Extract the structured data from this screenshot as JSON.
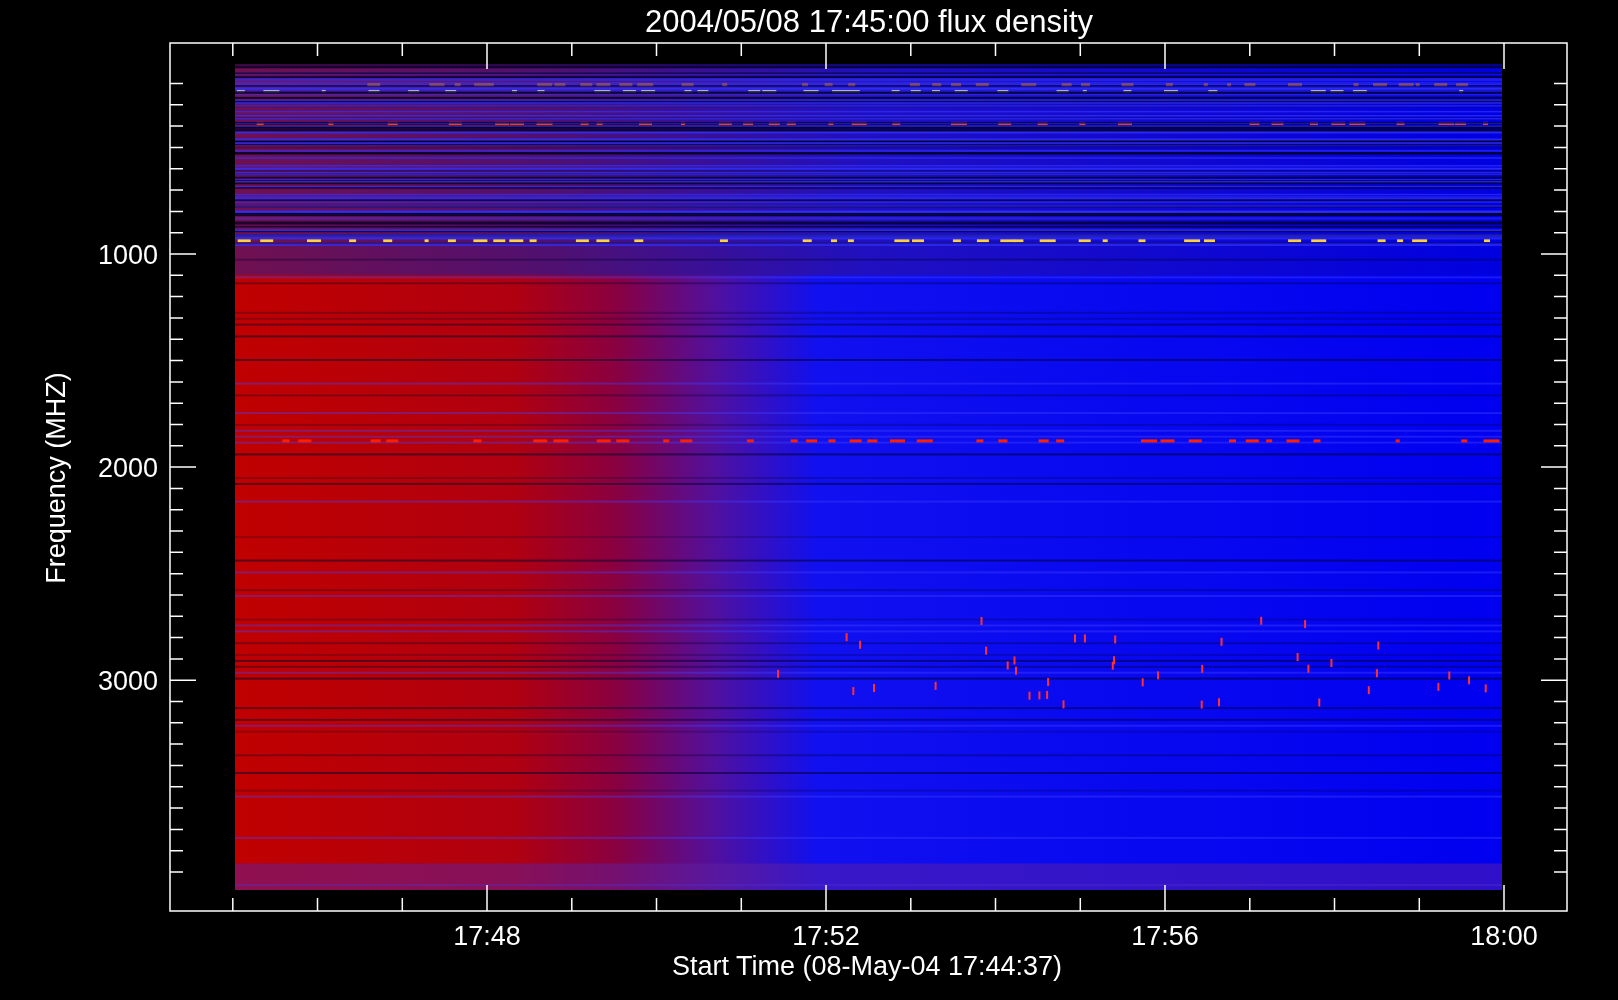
{
  "plot": {
    "title": "2004/05/08 17:45:00 flux density",
    "xlabel": "Start Time (08-May-04 17:44:37)",
    "ylabel": "Frequency (MHZ)",
    "yticks": [
      "1000",
      "2000",
      "3000"
    ],
    "xticks": [
      "17:48",
      "17:52",
      "17:56",
      "18:00"
    ]
  }
}
